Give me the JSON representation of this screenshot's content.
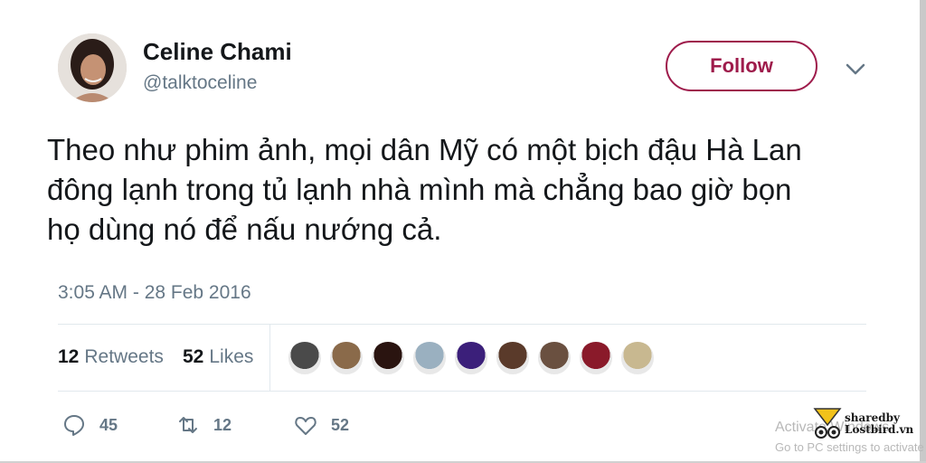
{
  "user": {
    "display_name": "Celine Chami",
    "handle": "@talktoceline"
  },
  "follow": {
    "label": "Follow"
  },
  "tweet": {
    "lines": [
      "Theo như phim ảnh, mọi dân Mỹ có một bịch đậu Hà Lan",
      "đông lạnh trong tủ lạnh nhà mình mà chẳng bao giờ bọn",
      "họ dùng nó để nấu nướng cả."
    ],
    "timestamp": "3:05 AM - 28 Feb 2016"
  },
  "stats": {
    "retweets_count": "12",
    "retweets_label": "Retweets",
    "likes_count": "52",
    "likes_label": "Likes"
  },
  "likers": [
    {
      "color": "#4a4a4a"
    },
    {
      "color": "#8a6a4a"
    },
    {
      "color": "#2a1410"
    },
    {
      "color": "#9ab0c0"
    },
    {
      "color": "#3b1f7a"
    },
    {
      "color": "#5a3a2a"
    },
    {
      "color": "#6a5040"
    },
    {
      "color": "#8a1a2a"
    },
    {
      "color": "#c8b890"
    }
  ],
  "actions": {
    "reply_count": "45",
    "retweet_count": "12",
    "like_count": "52"
  },
  "overlay": {
    "activate_line1": "Activate Windows",
    "activate_line2": "Go to PC settings to activate",
    "watermark_line1": "sharedby",
    "watermark_line2": "Lostbird.vn"
  },
  "colors": {
    "accent": "#9e1b4b",
    "secondary_text": "#657786",
    "divider": "#e1e8ed"
  }
}
